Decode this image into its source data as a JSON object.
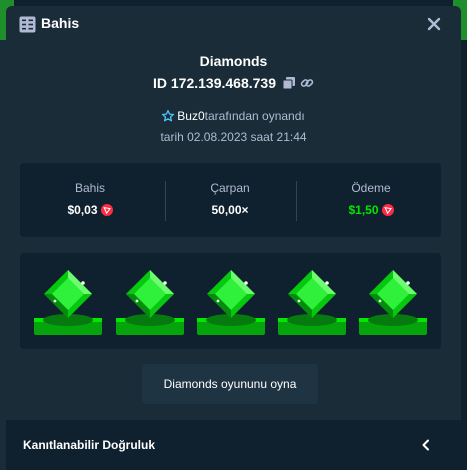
{
  "header": {
    "title": "Bahis",
    "icon": "bet-slip-icon",
    "close_icon": "close-icon"
  },
  "bet": {
    "game_name": "Diamonds",
    "id": "ID 172.139.468.739",
    "copy_icon": "copy-icon",
    "link_icon": "link-icon",
    "player_icon": "star-icon",
    "player_name": "Buz0",
    "played_by": "tarafından oynandı",
    "date": "tarih 02.08.2023 saat 21:44"
  },
  "stats": [
    {
      "label": "Bahis",
      "value": "$0,03",
      "currency_icon": "tron-coin-icon",
      "color": "#ffffff"
    },
    {
      "label": "Çarpan",
      "value": "50,00×",
      "currency_icon": "",
      "color": "#ffffff"
    },
    {
      "label": "Ödeme",
      "value": "$1,50",
      "currency_icon": "tron-coin-icon",
      "color": "#00e701"
    }
  ],
  "board": {
    "gems": [
      "green-gem-icon",
      "green-gem-icon",
      "green-gem-icon",
      "green-gem-icon",
      "green-gem-icon"
    ]
  },
  "play_button": {
    "label": "Diamonds oyununu oyna"
  },
  "footer": {
    "title": "Kanıtlanabilir Doğruluk",
    "icon": "chevron-left-icon"
  },
  "colors": {
    "background": "#0f212e",
    "panel": "#1a2c38",
    "accent_green": "#00e701",
    "muted_text": "#b1bad3"
  }
}
